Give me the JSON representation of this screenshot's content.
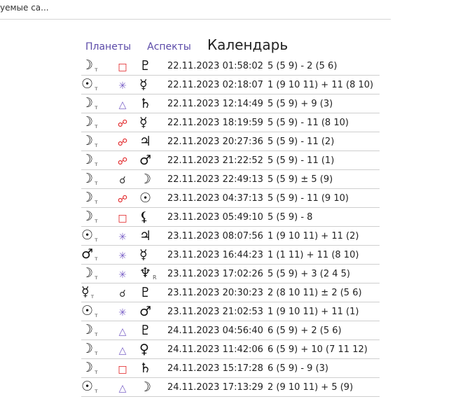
{
  "top_bar": {
    "text": "уемые са..."
  },
  "tabs": {
    "planets": "Планеты",
    "aspects": "Аспекты",
    "calendar": "Календарь"
  },
  "retro_mark": "R",
  "colors": {
    "square": "#e0191c",
    "opposition": "#e0191c",
    "trine": "#7b62c7",
    "sextile": "#7b62c7",
    "conjunction": "#333333",
    "tab_link": "#5b4aa8"
  },
  "rows": [
    {
      "p1": "☽",
      "p1_sub": "т",
      "aspect": "□",
      "aspect_name": "square",
      "p2": "♇",
      "p2_sub": "",
      "datetime": "22.11.2023 01:58:02",
      "houses": "5 (5 9) - 2 (5 6)"
    },
    {
      "p1": "☉",
      "p1_sub": "т",
      "aspect": "✳",
      "aspect_name": "sextile",
      "p2": "☿",
      "p2_sub": "",
      "datetime": "22.11.2023 02:18:07",
      "houses": "1 (9 10 11) + 11 (8 10)"
    },
    {
      "p1": "☽",
      "p1_sub": "т",
      "aspect": "△",
      "aspect_name": "trine",
      "p2": "♄",
      "p2_sub": "",
      "datetime": "22.11.2023 12:14:49",
      "houses": "5 (5 9) + 9 (3)"
    },
    {
      "p1": "☽",
      "p1_sub": "т",
      "aspect": "☍",
      "aspect_name": "opposition",
      "p2": "☿",
      "p2_sub": "",
      "datetime": "22.11.2023 18:19:59",
      "houses": "5 (5 9) - 11 (8 10)"
    },
    {
      "p1": "☽",
      "p1_sub": "т",
      "aspect": "☍",
      "aspect_name": "opposition",
      "p2": "♃",
      "p2_sub": "",
      "datetime": "22.11.2023 20:27:36",
      "houses": "5 (5 9) - 11 (2)"
    },
    {
      "p1": "☽",
      "p1_sub": "т",
      "aspect": "☍",
      "aspect_name": "opposition",
      "p2": "♂",
      "p2_sub": "",
      "datetime": "22.11.2023 21:22:52",
      "houses": "5 (5 9) - 11 (1)"
    },
    {
      "p1": "☽",
      "p1_sub": "т",
      "aspect": "☌",
      "aspect_name": "conjunction",
      "p2": "☽",
      "p2_sub": "",
      "datetime": "22.11.2023 22:49:13",
      "houses": "5 (5 9) ± 5 (9)"
    },
    {
      "p1": "☽",
      "p1_sub": "т",
      "aspect": "☍",
      "aspect_name": "opposition",
      "p2": "☉",
      "p2_sub": "",
      "datetime": "23.11.2023 04:37:13",
      "houses": "5 (5 9) - 11 (9 10)"
    },
    {
      "p1": "☽",
      "p1_sub": "т",
      "aspect": "□",
      "aspect_name": "square",
      "p2": "⚸",
      "p2_sub": "",
      "datetime": "23.11.2023 05:49:10",
      "houses": "5 (5 9) - 8"
    },
    {
      "p1": "☉",
      "p1_sub": "т",
      "aspect": "✳",
      "aspect_name": "sextile",
      "p2": "♃",
      "p2_sub": "",
      "datetime": "23.11.2023 08:07:56",
      "houses": "1 (9 10 11) + 11 (2)"
    },
    {
      "p1": "♂",
      "p1_sub": "т",
      "aspect": "✳",
      "aspect_name": "sextile",
      "p2": "☿",
      "p2_sub": "",
      "datetime": "23.11.2023 16:44:23",
      "houses": "1 (1 11) + 11 (8 10)"
    },
    {
      "p1": "☽",
      "p1_sub": "т",
      "aspect": "✳",
      "aspect_name": "sextile",
      "p2": "♆",
      "p2_sub": "R",
      "datetime": "23.11.2023 17:02:26",
      "houses": "5 (5 9) + 3 (2 4 5)"
    },
    {
      "p1": "☿",
      "p1_sub": "т",
      "aspect": "☌",
      "aspect_name": "conjunction",
      "p2": "♇",
      "p2_sub": "",
      "datetime": "23.11.2023 20:30:23",
      "houses": "2 (8 10 11) ± 2 (5 6)"
    },
    {
      "p1": "☉",
      "p1_sub": "т",
      "aspect": "✳",
      "aspect_name": "sextile",
      "p2": "♂",
      "p2_sub": "",
      "datetime": "23.11.2023 21:02:53",
      "houses": "1 (9 10 11) + 11 (1)"
    },
    {
      "p1": "☽",
      "p1_sub": "т",
      "aspect": "△",
      "aspect_name": "trine",
      "p2": "♇",
      "p2_sub": "",
      "datetime": "24.11.2023 04:56:40",
      "houses": "6 (5 9) + 2 (5 6)"
    },
    {
      "p1": "☽",
      "p1_sub": "т",
      "aspect": "△",
      "aspect_name": "trine",
      "p2": "♀",
      "p2_sub": "",
      "datetime": "24.11.2023 11:42:06",
      "houses": "6 (5 9) + 10 (7 11 12)"
    },
    {
      "p1": "☽",
      "p1_sub": "т",
      "aspect": "□",
      "aspect_name": "square",
      "p2": "♄",
      "p2_sub": "",
      "datetime": "24.11.2023 15:17:28",
      "houses": "6 (5 9) - 9 (3)"
    },
    {
      "p1": "☉",
      "p1_sub": "т",
      "aspect": "△",
      "aspect_name": "trine",
      "p2": "☽",
      "p2_sub": "",
      "datetime": "24.11.2023 17:13:29",
      "houses": "2 (9 10 11) + 5 (9)"
    }
  ]
}
